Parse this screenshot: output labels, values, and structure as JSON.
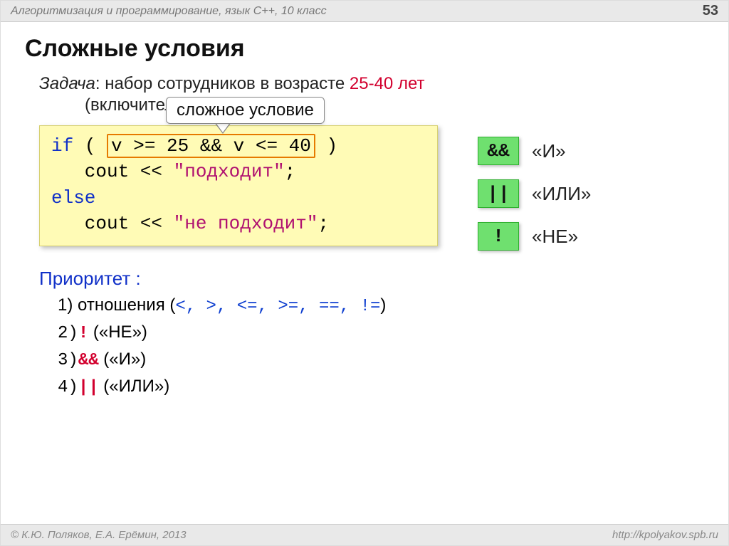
{
  "header": {
    "subject": "Алгоритмизация и программирование, язык  C++, 10 класс",
    "page": "53"
  },
  "title": "Сложные условия",
  "task": {
    "label": "Задача",
    "text_before": ": набор сотрудников в возрасте ",
    "highlight": "25-40 лет",
    "inclusive": "(включительно)."
  },
  "callout": "сложное условие",
  "code": {
    "l1_if": "if",
    "l1_open": " ( ",
    "l1_cond": "v >= 25 && v <= 40",
    "l1_close": " )",
    "l2_cout": "   cout << ",
    "l2_str": "\"подходит\"",
    "l2_semi": ";",
    "l3_else": "else",
    "l4_cout": "   cout << ",
    "l4_str": "\"не подходит\"",
    "l4_semi": ";"
  },
  "ops": [
    {
      "sym": "&&",
      "label": "«И»"
    },
    {
      "sym": "||",
      "label": "«ИЛИ»"
    },
    {
      "sym": "!",
      "label": "«НЕ»"
    }
  ],
  "priority": {
    "title": "Приоритет :",
    "items": [
      {
        "n": "1)",
        "pre": " отношения (",
        "ops": "<, >, <=, >=, ==, !=",
        "post": ")"
      },
      {
        "n": "2)",
        "op": "!",
        "label": " («НЕ»)"
      },
      {
        "n": "3)",
        "op": "&&",
        "label": " («И»)"
      },
      {
        "n": "4)",
        "op": "||",
        "label": " («ИЛИ»)"
      }
    ]
  },
  "footer": {
    "copyright": "© К.Ю. Поляков, Е.А. Ерёмин, 2013",
    "url": "http://kpolyakov.spb.ru"
  }
}
